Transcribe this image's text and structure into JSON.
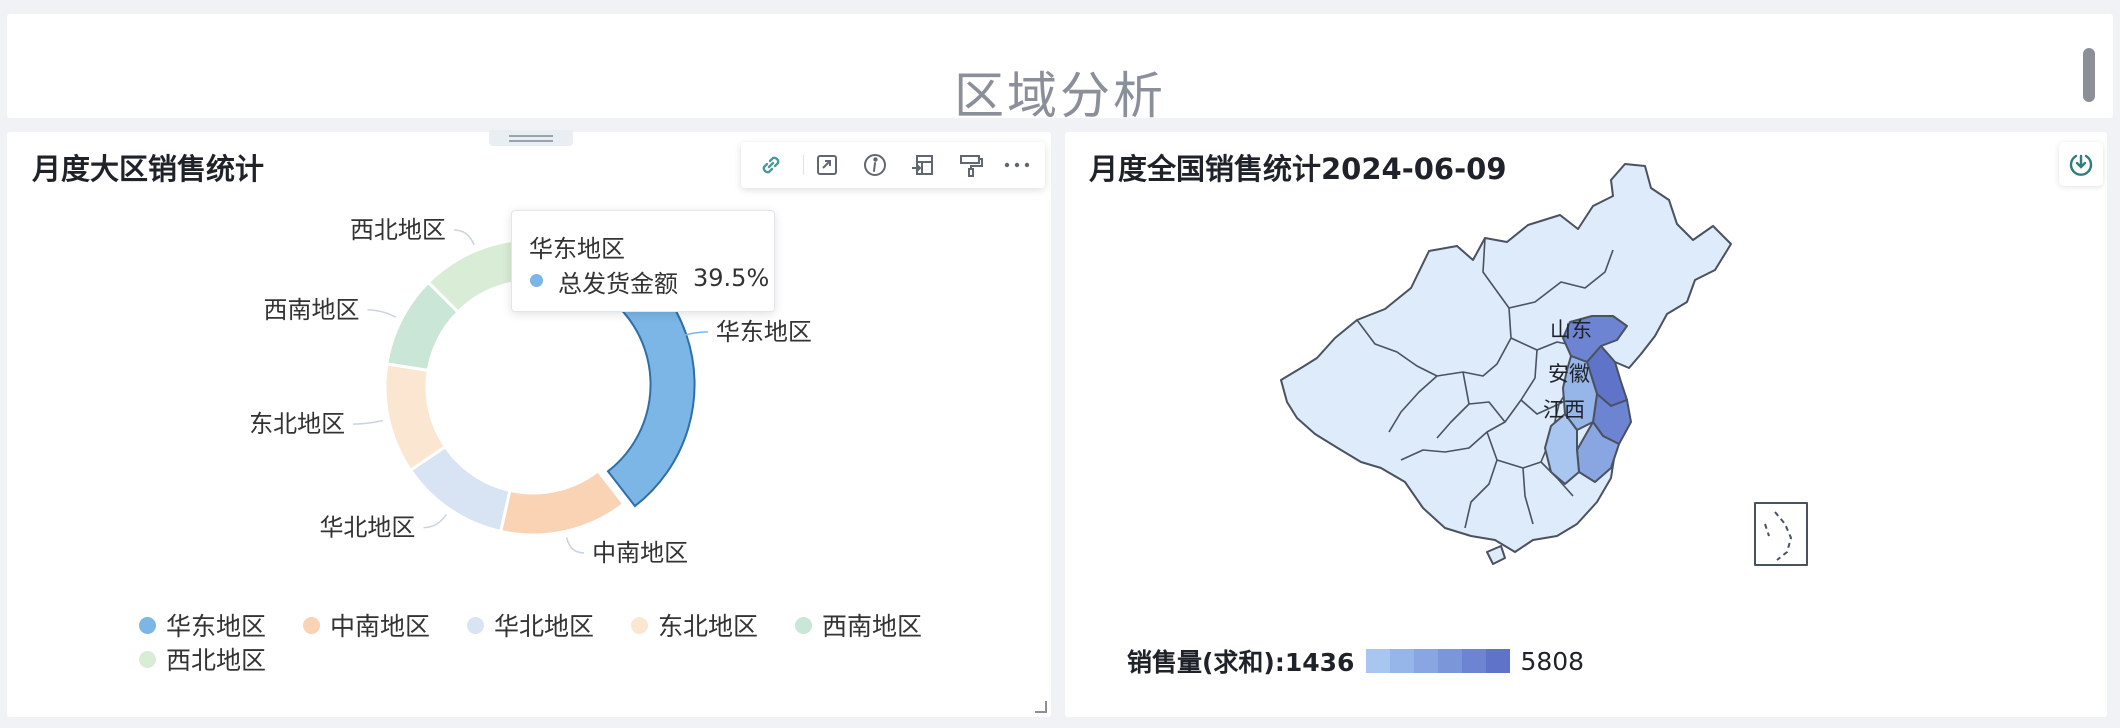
{
  "page": {
    "title": "区域分析"
  },
  "left_card": {
    "title": "月度大区销售统计",
    "toolbar": [
      "link-icon",
      "fullscreen-icon",
      "info-icon",
      "export-icon",
      "format-painter-icon",
      "more-icon"
    ],
    "tooltip": {
      "title": "华东地区",
      "metric": "总发货金额",
      "value": "39.5%"
    }
  },
  "right_card": {
    "title": "月度全国销售统计2024-06-09",
    "map_labels": [
      "山东",
      "安徽",
      "江西"
    ],
    "legend": {
      "label": "销售量(求和):1436",
      "max": "5808"
    }
  },
  "chart_data": [
    {
      "type": "pie",
      "title": "月度大区销售统计",
      "donut": true,
      "highlighted": "华东地区",
      "categories": [
        "华东地区",
        "中南地区",
        "华北地区",
        "东北地区",
        "西南地区",
        "西北地区"
      ],
      "values": [
        39.5,
        14,
        12,
        12,
        10,
        12.5
      ],
      "colors": [
        "#7bb6e6",
        "#fad2b4",
        "#d8e4f3",
        "#fbe6d2",
        "#c9e6d6",
        "#d9ecd6"
      ],
      "legend_position": "bottom"
    },
    {
      "type": "heatmap",
      "title": "月度全国销售统计2024-06-09",
      "map": "China provinces",
      "regions": [
        "山东",
        "安徽",
        "江西"
      ],
      "measure": "销售量(求和)",
      "range": [
        1436,
        5808
      ],
      "scale_colors": [
        "#a8c6f0",
        "#96b6ea",
        "#8aa6e2",
        "#7c96da",
        "#6d84d2",
        "#5f73c9"
      ]
    }
  ]
}
